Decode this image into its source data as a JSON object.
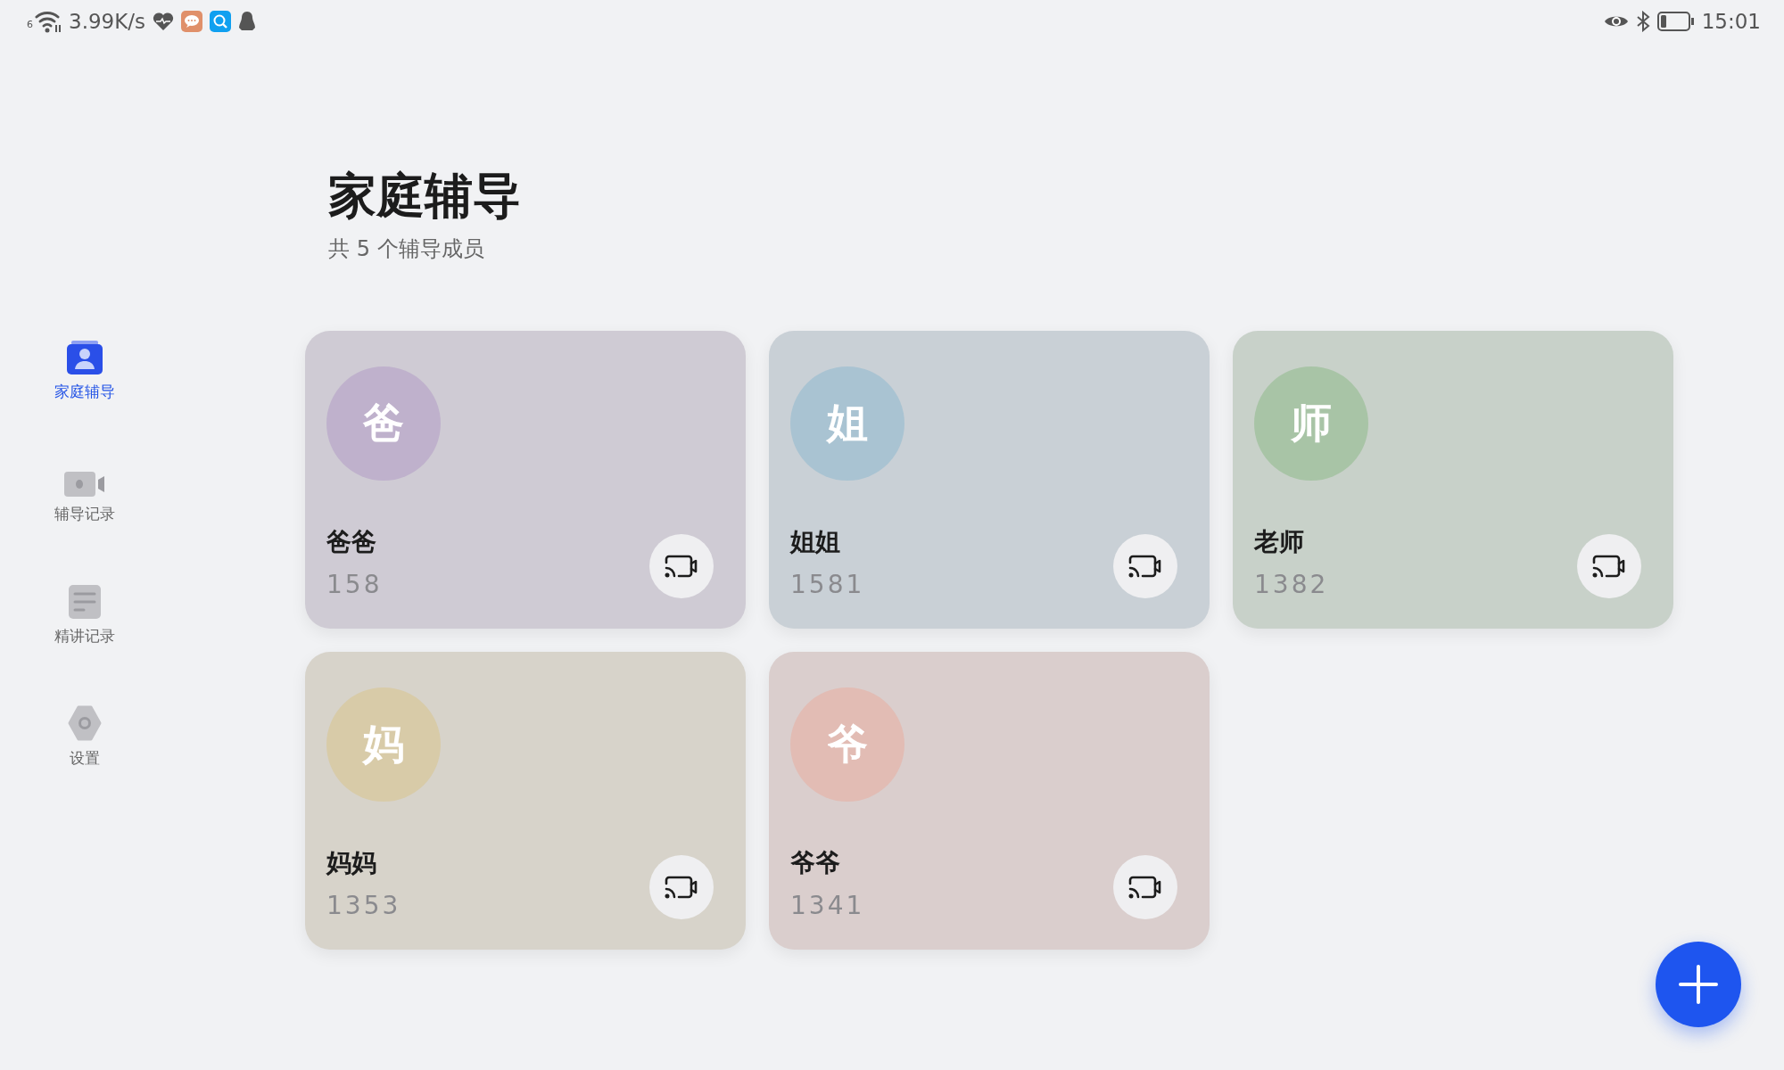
{
  "status_bar": {
    "network_badge": "6",
    "speed": "3.99K/s",
    "time": "15:01"
  },
  "sidebar": {
    "items": [
      {
        "kind": "members",
        "label": "家庭辅导",
        "selected": true
      },
      {
        "kind": "video",
        "label": "辅导记录",
        "selected": false
      },
      {
        "kind": "notes",
        "label": "精讲记录",
        "selected": false
      },
      {
        "kind": "settings",
        "label": "设置",
        "selected": false
      }
    ]
  },
  "header": {
    "title": "家庭辅导",
    "subtitle": "共 5 个辅导成员"
  },
  "members": [
    {
      "avatar": "爸",
      "name": "爸爸",
      "phone": "158",
      "color": "#bfb1cc"
    },
    {
      "avatar": "姐",
      "name": "姐姐",
      "phone": "1581",
      "color": "#a9c3d2"
    },
    {
      "avatar": "师",
      "name": "老师",
      "phone": "1382",
      "color": "#a8c4a6"
    },
    {
      "avatar": "妈",
      "name": "妈妈",
      "phone": "1353",
      "color": "#d8cba8"
    },
    {
      "avatar": "爷",
      "name": "爷爷",
      "phone": "1341",
      "color": "#e2bcb4"
    }
  ]
}
